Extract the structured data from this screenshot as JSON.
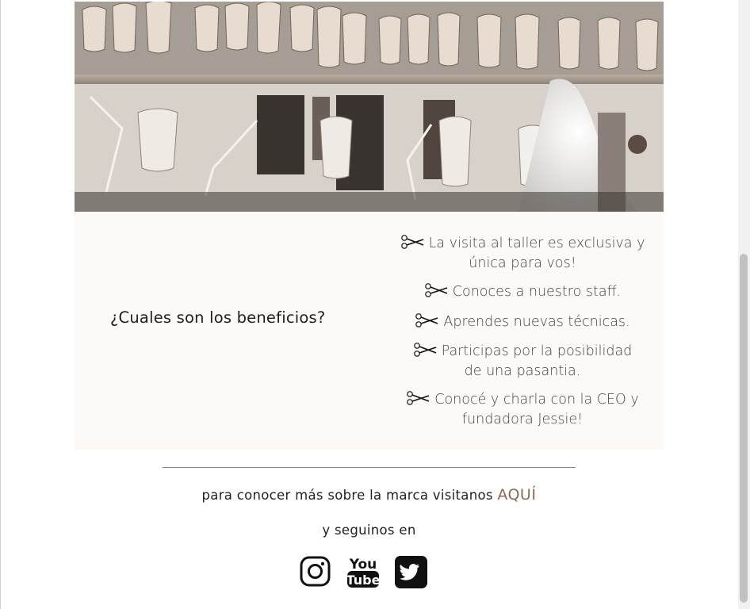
{
  "hero": {
    "image_name": "atelier-workshop-photo"
  },
  "benefits": {
    "title": "¿Cuales son los beneficios?",
    "items": [
      {
        "line1": "La visita al taller es exclusiva y",
        "line2": "única para vos!"
      },
      {
        "line1": "Conoces a nuestro staff.",
        "line2": ""
      },
      {
        "line1": "Aprendes nuevas técnicas.",
        "line2": ""
      },
      {
        "line1": "Participas por la posibilidad",
        "line2": "de una pasantia."
      },
      {
        "line1": "Conocé y charla con la CEO y",
        "line2": "fundadora Jessie!"
      }
    ],
    "bullet_icon": "scissors-icon"
  },
  "footer": {
    "more_text": "para conocer más sobre la marca visitanos ",
    "more_link": "AQUÍ",
    "follow_text": "y seguinos en",
    "social": [
      {
        "name": "instagram",
        "icon": "instagram-icon"
      },
      {
        "name": "youtube",
        "icon": "youtube-icon",
        "label_top": "You",
        "label_bottom": "Tube"
      },
      {
        "name": "twitter",
        "icon": "twitter-icon"
      }
    ]
  },
  "colors": {
    "panel_bg": "#fdf9f6",
    "link": "#8a6a54",
    "divider": "#8a8a8a"
  }
}
